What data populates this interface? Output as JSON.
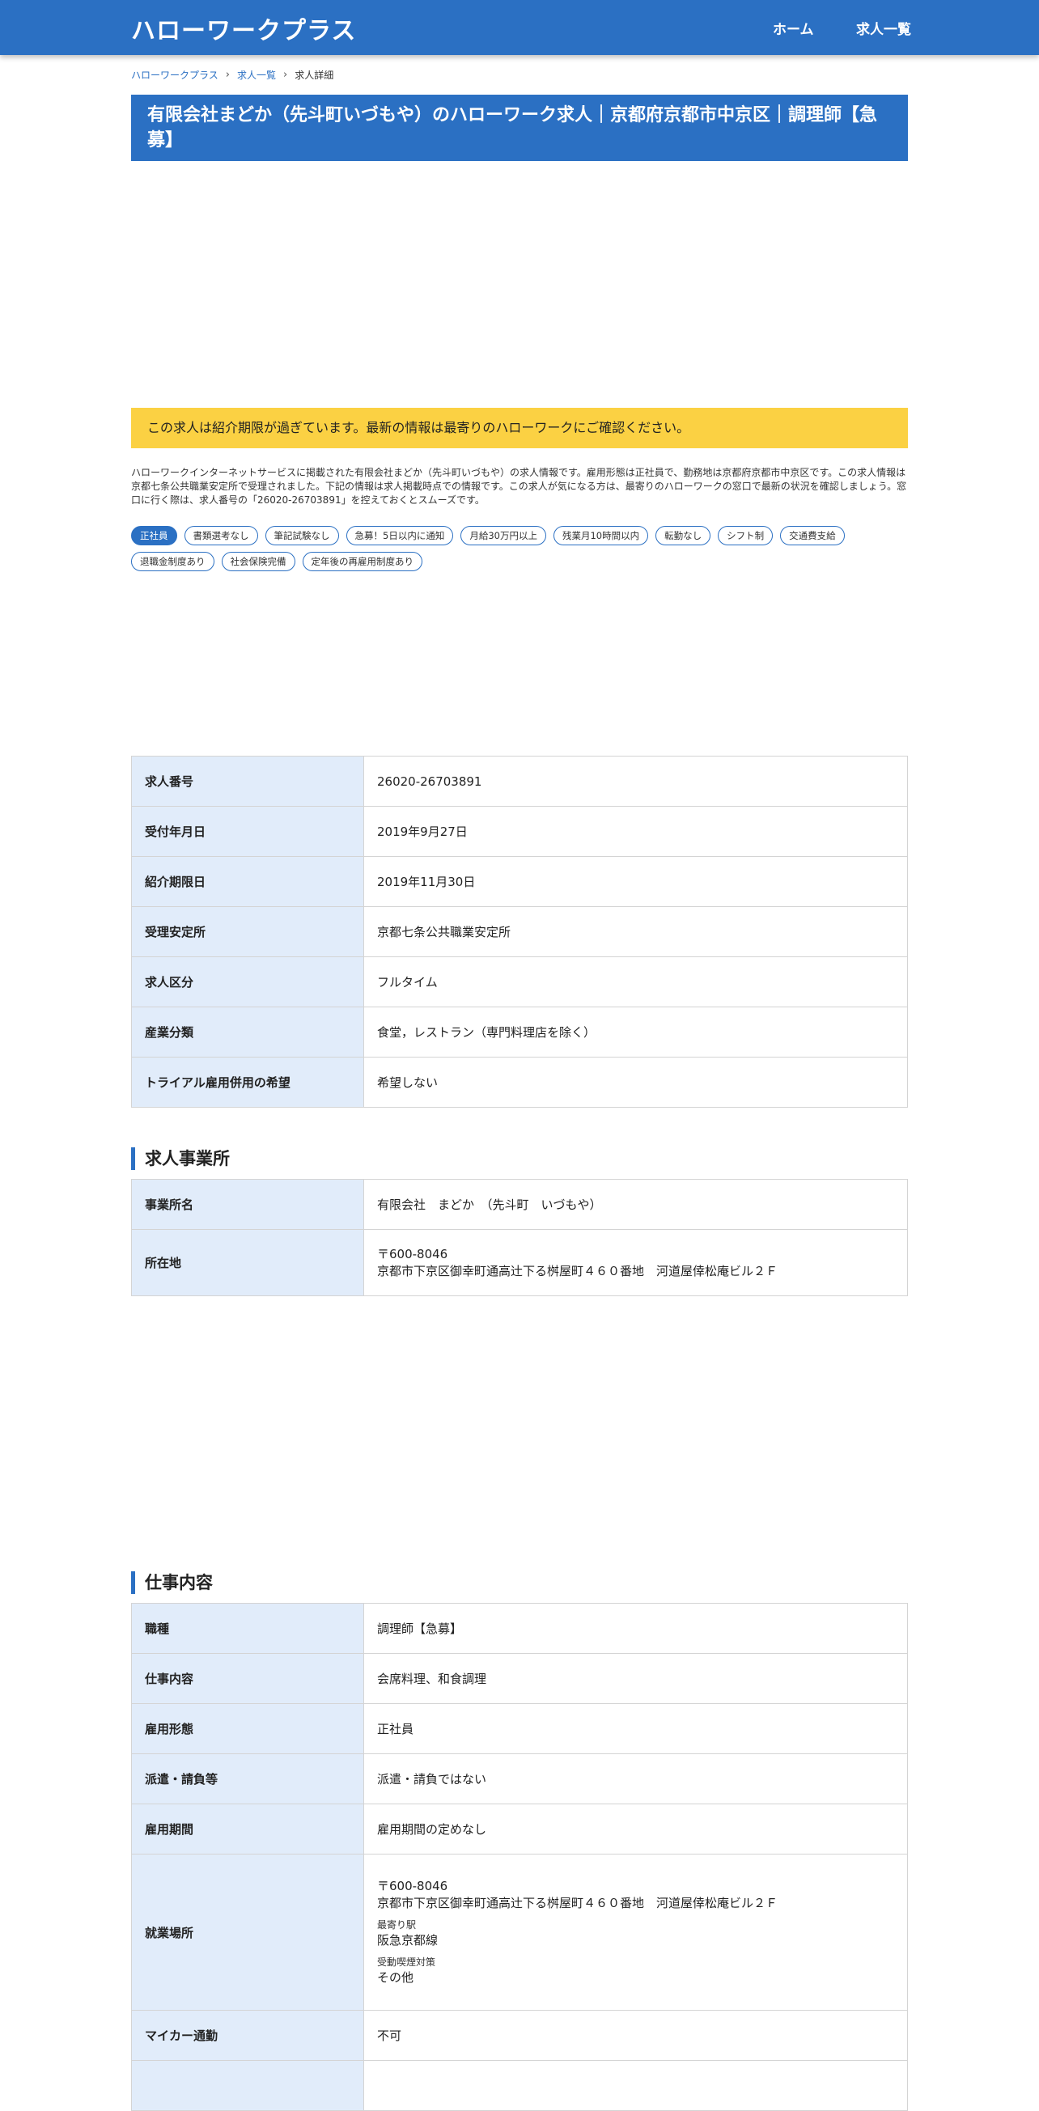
{
  "header": {
    "brand": "ハローワークプラス",
    "nav": [
      "ホーム",
      "求人一覧"
    ]
  },
  "breadcrumb": [
    "ハローワークプラス",
    "求人一覧",
    "求人詳細"
  ],
  "title": "有限会社まどか（先斗町いづもや）のハローワーク求人｜京都府京都市中京区｜調理師【急募】",
  "notice": "この求人は紹介期限が過ぎています。最新の情報は最寄りのハローワークにご確認ください。",
  "intro": "ハローワークインターネットサービスに掲載された有限会社まどか（先斗町いづもや）の求人情報です。雇用形態は正社員で、勤務地は京都府京都市中京区です。この求人情報は京都七条公共職業安定所で受理されました。下記の情報は求人掲載時点での情報です。この求人が気になる方は、最寄りのハローワークの窓口で最新の状況を確認しましょう。窓口に行く際は、求人番号の「26020-26703891」を控えておくとスムーズです。",
  "tags": [
    "正社員",
    "書類選考なし",
    "筆記試験なし",
    "急募！5日以内に通知",
    "月給30万円以上",
    "残業月10時間以内",
    "転勤なし",
    "シフト制",
    "交通費支給",
    "退職金制度あり",
    "社会保険完備",
    "定年後の再雇用制度あり"
  ],
  "basic": [
    {
      "label": "求人番号",
      "value": "26020-26703891"
    },
    {
      "label": "受付年月日",
      "value": "2019年9月27日"
    },
    {
      "label": "紹介期限日",
      "value": "2019年11月30日"
    },
    {
      "label": "受理安定所",
      "value": "京都七条公共職業安定所"
    },
    {
      "label": "求人区分",
      "value": "フルタイム"
    },
    {
      "label": "産業分類",
      "value": "食堂，レストラン（専門料理店を除く）"
    },
    {
      "label": "トライアル雇用併用の希望",
      "value": "希望しない"
    }
  ],
  "office": {
    "heading": "求人事業所",
    "name_label": "事業所名",
    "name": "有限会社　まどか　（先斗町　いづもや）",
    "address_label": "所在地",
    "postal": "〒600-8046",
    "address": "京都市下京区御幸町通高辻下る桝屋町４６０番地　河道屋倖松庵ビル２Ｆ"
  },
  "job": {
    "heading": "仕事内容",
    "rows": [
      {
        "label": "職種",
        "value": "調理師【急募】"
      },
      {
        "label": "仕事内容",
        "value": "会席料理、和食調理"
      },
      {
        "label": "雇用形態",
        "value": "正社員"
      },
      {
        "label": "派遣・請負等",
        "value": "派遣・請負ではない"
      },
      {
        "label": "雇用期間",
        "value": "雇用期間の定めなし"
      }
    ],
    "workplace_label": "就業場所",
    "workplace_postal": "〒600-8046",
    "workplace_address": "京都市下京区御幸町通高辻下る桝屋町４６０番地　河道屋倖松庵ビル２Ｆ",
    "station_label": "最寄り駅",
    "station": "阪急京都線",
    "smoking_label": "受動喫煙対策",
    "smoking": "その他",
    "car_label": "マイカー通勤",
    "car": "不可"
  }
}
